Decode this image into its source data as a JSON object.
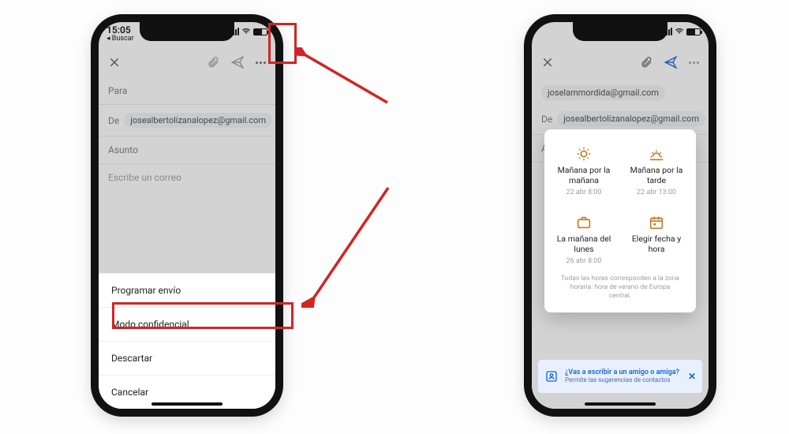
{
  "statusbar": {
    "time_left": "15:05",
    "back_left": "◂ Buscar",
    "time_right": ""
  },
  "compose": {
    "to_label": "Para",
    "from_label": "De",
    "subject_label": "Asunto",
    "body_placeholder": "Escribe un correo",
    "from_email": "josealbertolizanalopez@gmail.com",
    "to_email_right": "joselammordida@gmail.com"
  },
  "sheet": {
    "items": [
      "Programar envío",
      "Modo confidencial",
      "Descartar",
      "Cancelar"
    ]
  },
  "schedule": {
    "options": [
      {
        "title": "Mañana por la mañana",
        "date": "22 abr 8:00"
      },
      {
        "title": "Mañana por la tarde",
        "date": "22 abr 13:00"
      },
      {
        "title": "La mañana del lunes",
        "date": "26 abr 8:00"
      },
      {
        "title": "Elegir fecha y hora",
        "date": ""
      }
    ],
    "timezone_note": "Todas las horas corresponden a la zona horaria: hora de verano de Europa central."
  },
  "banner": {
    "line1": "¿Vas a escribir a un amigo o amiga?",
    "line2": "Permite las sugerencias de contactos",
    "close": "✕"
  }
}
